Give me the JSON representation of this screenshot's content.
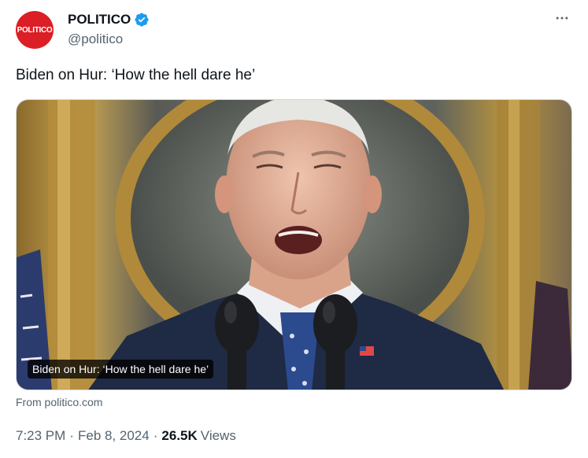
{
  "author": {
    "avatar_text": "POLITICO",
    "name": "POLITICO",
    "handle": "@politico",
    "verified_color": "#1d9bf0"
  },
  "more_icon": "more-horizontal-icon",
  "tweet": {
    "text": "Biden on Hur: ‘How the hell dare he’"
  },
  "card": {
    "caption": "Biden on Hur: ‘How the hell dare he’",
    "source": "From politico.com"
  },
  "meta": {
    "time": "7:23 PM",
    "separator": "·",
    "date": "Feb 8, 2024",
    "views_count": "26.5K",
    "views_label": "Views"
  },
  "colors": {
    "brand": "#dc1e26",
    "secondary_text": "#536471",
    "primary_text": "#0f1419"
  }
}
